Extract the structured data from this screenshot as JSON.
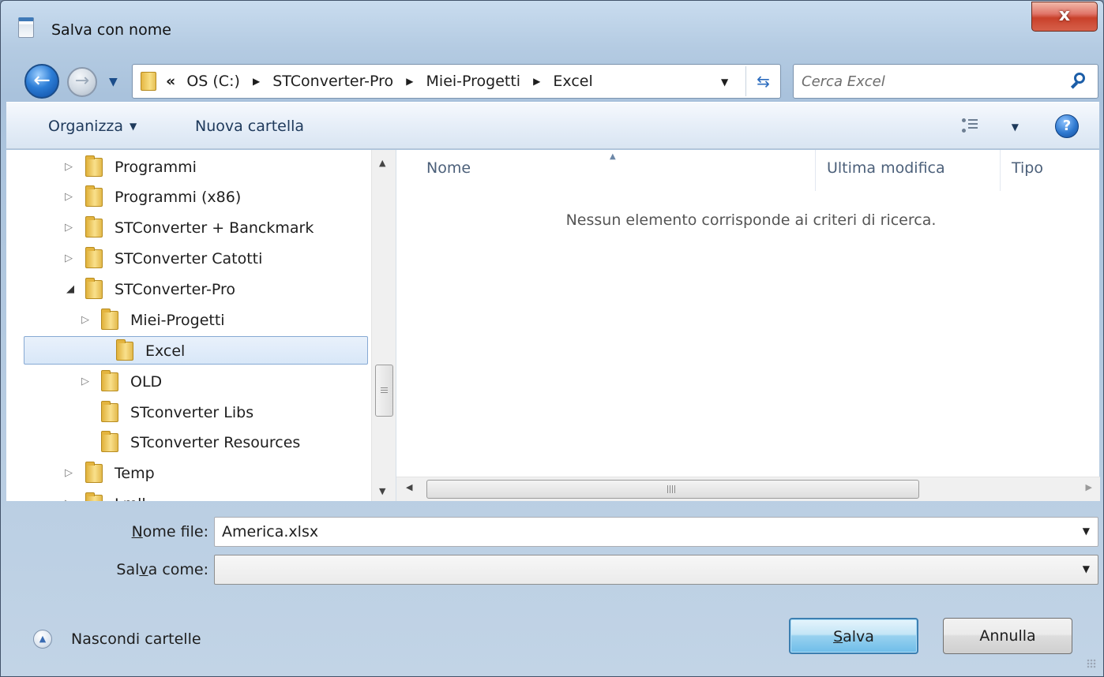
{
  "window": {
    "title": "Salva con nome",
    "close_label": "x"
  },
  "nav": {
    "back_label": "←",
    "forward_label": "→",
    "breadcrumb": {
      "overflow": "«",
      "separator": "▶",
      "items": [
        "OS (C:)",
        "STConverter-Pro",
        "Miei-Progetti",
        "Excel"
      ]
    },
    "search_placeholder": "Cerca Excel"
  },
  "toolbar": {
    "organize_label": "Organizza",
    "new_folder_label": "Nuova cartella",
    "help_label": "?"
  },
  "tree": {
    "items": [
      {
        "label": "Programmi",
        "expander": "▷"
      },
      {
        "label": "Programmi (x86)",
        "expander": "▷"
      },
      {
        "label": "STConverter + Banckmark",
        "expander": "▷"
      },
      {
        "label": "STConverter Catotti",
        "expander": "▷"
      },
      {
        "label": "STConverter-Pro",
        "expander": "◢"
      },
      {
        "label": "Miei-Progetti",
        "expander": "▷"
      },
      {
        "label": "Excel",
        "expander": ""
      },
      {
        "label": "OLD",
        "expander": "▷"
      },
      {
        "label": "STconverter Libs",
        "expander": ""
      },
      {
        "label": "STconverter Resources",
        "expander": ""
      },
      {
        "label": "Temp",
        "expander": "▷"
      },
      {
        "label": "Lmll...",
        "expander": "▷"
      }
    ],
    "selected": "Excel"
  },
  "content": {
    "columns": [
      "Nome",
      "Ultima modifica",
      "Tipo"
    ],
    "empty_message": "Nessun elemento corrisponde ai criteri di ricerca.",
    "sort_indicator": "▲"
  },
  "form": {
    "filename_label_pre": "",
    "filename_label_ul": "N",
    "filename_label_post": "ome file:",
    "filename_value": "America.xlsx",
    "savetype_label_pre": "Sal",
    "savetype_label_ul": "v",
    "savetype_label_post": "a come:",
    "savetype_value": ""
  },
  "footer": {
    "toggle_folders_label": "Nascondi cartelle",
    "save_ul": "S",
    "save_rest": "alva",
    "cancel_label": "Annulla"
  }
}
